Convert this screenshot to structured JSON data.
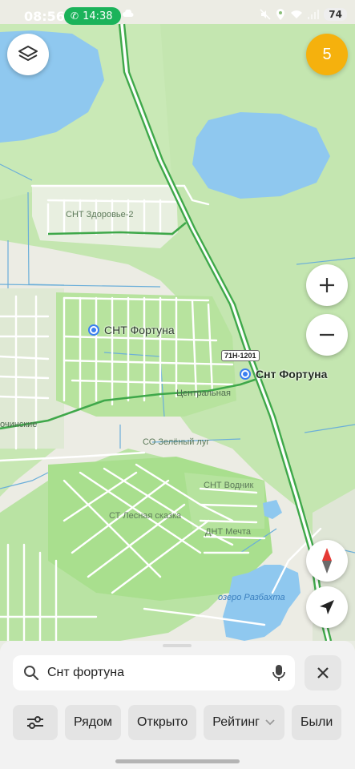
{
  "status_bar": {
    "time": "08:56",
    "call_time": "14:38",
    "battery": "74"
  },
  "map": {
    "cluster_count": "5",
    "road_shield": "71Н-1201",
    "labels": {
      "snt_zdorovye": "СНТ Здоровье-2",
      "snt_fortuna_poi": "СНТ Фортуна",
      "snt_fortuna_result": "Снт Фортуна",
      "tsentralnaya": "Центральная",
      "ochinskie": "очинские",
      "so_zeleny_lug": "СО Зелёный луг",
      "snt_vodnik": "СНТ Водник",
      "st_lesnaya_skazka": "СТ Лесная сказка",
      "dnt_mechta": "ДНТ Мечта",
      "ozero_razbakhta": "озеро Разбахта"
    },
    "colors": {
      "forest": "#bfe3a8",
      "park": "#aee39a",
      "water": "#8ec7ee",
      "highway": "#3fa84a",
      "poi_pin": "#3b7ff0",
      "cluster": "#f5b10d"
    }
  },
  "search": {
    "query": "Снт фортуна"
  },
  "filters": {
    "items": [
      "Рядом",
      "Открыто",
      "Рейтинг",
      "Были"
    ]
  }
}
